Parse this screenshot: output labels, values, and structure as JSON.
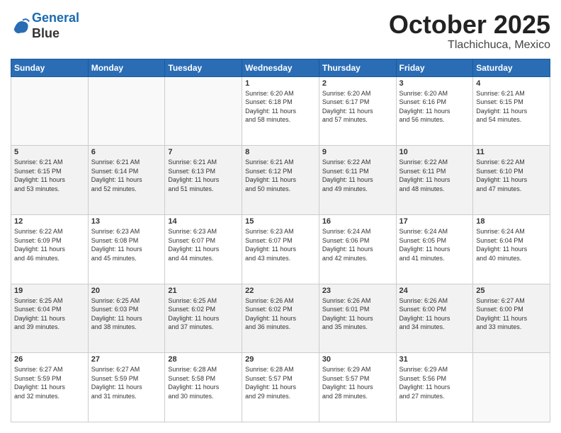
{
  "header": {
    "logo_line1": "General",
    "logo_line2": "Blue",
    "month": "October 2025",
    "location": "Tlachichuca, Mexico"
  },
  "weekdays": [
    "Sunday",
    "Monday",
    "Tuesday",
    "Wednesday",
    "Thursday",
    "Friday",
    "Saturday"
  ],
  "weeks": [
    [
      {
        "day": "",
        "info": ""
      },
      {
        "day": "",
        "info": ""
      },
      {
        "day": "",
        "info": ""
      },
      {
        "day": "1",
        "info": "Sunrise: 6:20 AM\nSunset: 6:18 PM\nDaylight: 11 hours\nand 58 minutes."
      },
      {
        "day": "2",
        "info": "Sunrise: 6:20 AM\nSunset: 6:17 PM\nDaylight: 11 hours\nand 57 minutes."
      },
      {
        "day": "3",
        "info": "Sunrise: 6:20 AM\nSunset: 6:16 PM\nDaylight: 11 hours\nand 56 minutes."
      },
      {
        "day": "4",
        "info": "Sunrise: 6:21 AM\nSunset: 6:15 PM\nDaylight: 11 hours\nand 54 minutes."
      }
    ],
    [
      {
        "day": "5",
        "info": "Sunrise: 6:21 AM\nSunset: 6:15 PM\nDaylight: 11 hours\nand 53 minutes."
      },
      {
        "day": "6",
        "info": "Sunrise: 6:21 AM\nSunset: 6:14 PM\nDaylight: 11 hours\nand 52 minutes."
      },
      {
        "day": "7",
        "info": "Sunrise: 6:21 AM\nSunset: 6:13 PM\nDaylight: 11 hours\nand 51 minutes."
      },
      {
        "day": "8",
        "info": "Sunrise: 6:21 AM\nSunset: 6:12 PM\nDaylight: 11 hours\nand 50 minutes."
      },
      {
        "day": "9",
        "info": "Sunrise: 6:22 AM\nSunset: 6:11 PM\nDaylight: 11 hours\nand 49 minutes."
      },
      {
        "day": "10",
        "info": "Sunrise: 6:22 AM\nSunset: 6:11 PM\nDaylight: 11 hours\nand 48 minutes."
      },
      {
        "day": "11",
        "info": "Sunrise: 6:22 AM\nSunset: 6:10 PM\nDaylight: 11 hours\nand 47 minutes."
      }
    ],
    [
      {
        "day": "12",
        "info": "Sunrise: 6:22 AM\nSunset: 6:09 PM\nDaylight: 11 hours\nand 46 minutes."
      },
      {
        "day": "13",
        "info": "Sunrise: 6:23 AM\nSunset: 6:08 PM\nDaylight: 11 hours\nand 45 minutes."
      },
      {
        "day": "14",
        "info": "Sunrise: 6:23 AM\nSunset: 6:07 PM\nDaylight: 11 hours\nand 44 minutes."
      },
      {
        "day": "15",
        "info": "Sunrise: 6:23 AM\nSunset: 6:07 PM\nDaylight: 11 hours\nand 43 minutes."
      },
      {
        "day": "16",
        "info": "Sunrise: 6:24 AM\nSunset: 6:06 PM\nDaylight: 11 hours\nand 42 minutes."
      },
      {
        "day": "17",
        "info": "Sunrise: 6:24 AM\nSunset: 6:05 PM\nDaylight: 11 hours\nand 41 minutes."
      },
      {
        "day": "18",
        "info": "Sunrise: 6:24 AM\nSunset: 6:04 PM\nDaylight: 11 hours\nand 40 minutes."
      }
    ],
    [
      {
        "day": "19",
        "info": "Sunrise: 6:25 AM\nSunset: 6:04 PM\nDaylight: 11 hours\nand 39 minutes."
      },
      {
        "day": "20",
        "info": "Sunrise: 6:25 AM\nSunset: 6:03 PM\nDaylight: 11 hours\nand 38 minutes."
      },
      {
        "day": "21",
        "info": "Sunrise: 6:25 AM\nSunset: 6:02 PM\nDaylight: 11 hours\nand 37 minutes."
      },
      {
        "day": "22",
        "info": "Sunrise: 6:26 AM\nSunset: 6:02 PM\nDaylight: 11 hours\nand 36 minutes."
      },
      {
        "day": "23",
        "info": "Sunrise: 6:26 AM\nSunset: 6:01 PM\nDaylight: 11 hours\nand 35 minutes."
      },
      {
        "day": "24",
        "info": "Sunrise: 6:26 AM\nSunset: 6:00 PM\nDaylight: 11 hours\nand 34 minutes."
      },
      {
        "day": "25",
        "info": "Sunrise: 6:27 AM\nSunset: 6:00 PM\nDaylight: 11 hours\nand 33 minutes."
      }
    ],
    [
      {
        "day": "26",
        "info": "Sunrise: 6:27 AM\nSunset: 5:59 PM\nDaylight: 11 hours\nand 32 minutes."
      },
      {
        "day": "27",
        "info": "Sunrise: 6:27 AM\nSunset: 5:59 PM\nDaylight: 11 hours\nand 31 minutes."
      },
      {
        "day": "28",
        "info": "Sunrise: 6:28 AM\nSunset: 5:58 PM\nDaylight: 11 hours\nand 30 minutes."
      },
      {
        "day": "29",
        "info": "Sunrise: 6:28 AM\nSunset: 5:57 PM\nDaylight: 11 hours\nand 29 minutes."
      },
      {
        "day": "30",
        "info": "Sunrise: 6:29 AM\nSunset: 5:57 PM\nDaylight: 11 hours\nand 28 minutes."
      },
      {
        "day": "31",
        "info": "Sunrise: 6:29 AM\nSunset: 5:56 PM\nDaylight: 11 hours\nand 27 minutes."
      },
      {
        "day": "",
        "info": ""
      }
    ]
  ]
}
